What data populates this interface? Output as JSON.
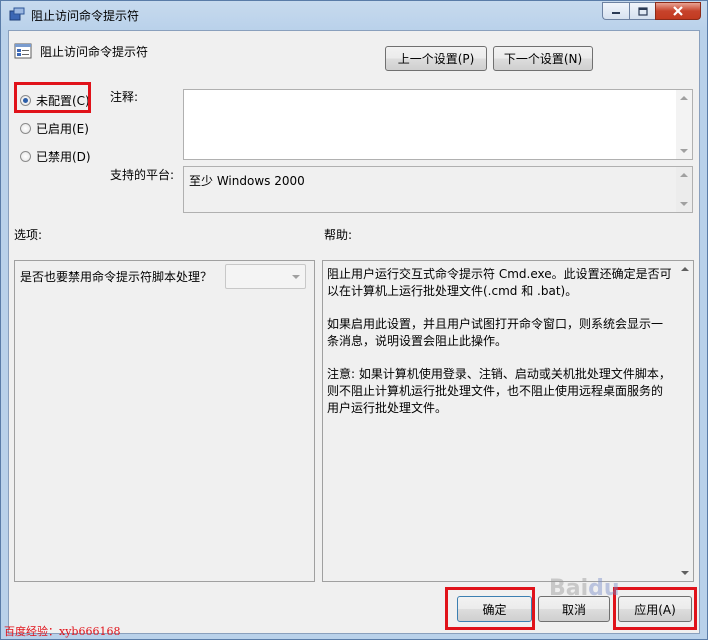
{
  "window": {
    "title": "阻止访问命令提示符"
  },
  "policy": {
    "title": "阻止访问命令提示符"
  },
  "nav": {
    "prev_label": "上一个设置(P)",
    "next_label": "下一个设置(N)"
  },
  "state": {
    "selected": "not_configured",
    "options": [
      {
        "id": "not_configured",
        "label": "未配置(C)"
      },
      {
        "id": "enabled",
        "label": "已启用(E)"
      },
      {
        "id": "disabled",
        "label": "已禁用(D)"
      }
    ]
  },
  "comment": {
    "label": "注释:",
    "value": ""
  },
  "platform": {
    "label": "支持的平台:",
    "value": "至少 Windows 2000"
  },
  "options_panel": {
    "label": "选项:",
    "question": "是否也要禁用命令提示符脚本处理？",
    "dropdown_value": ""
  },
  "help_panel": {
    "label": "帮助:",
    "paragraphs": [
      "阻止用户运行交互式命令提示符 Cmd.exe。此设置还确定是否可以在计算机上运行批处理文件(.cmd 和 .bat)。",
      "如果启用此设置，并且用户试图打开命令窗口，则系统会显示一条消息，说明设置会阻止此操作。",
      "注意: 如果计算机使用登录、注销、启动或关机批处理文件脚本，则不阻止计算机运行批处理文件，也不阻止使用远程桌面服务的用户运行批处理文件。"
    ]
  },
  "footer": {
    "ok_label": "确定",
    "cancel_label": "取消",
    "apply_label": "应用(A)"
  },
  "watermark": "百度经验：xyb666168",
  "colors": {
    "highlight": "#e0121a",
    "titlebar": "#b9d1ea",
    "close": "#c7432b"
  }
}
